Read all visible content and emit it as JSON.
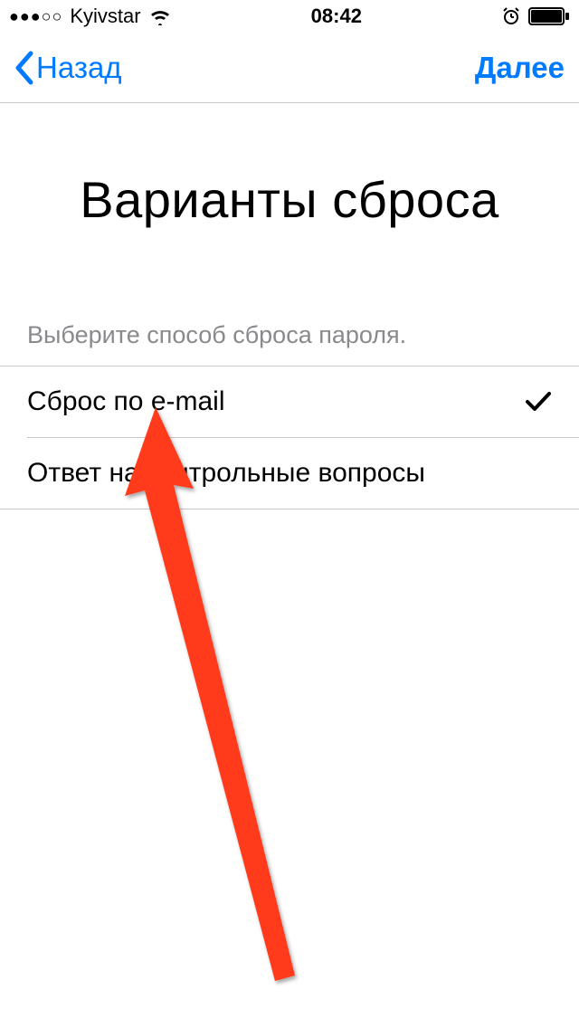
{
  "status_bar": {
    "signal_dots": "●●●○○",
    "carrier": "Kyivstar",
    "time": "08:42"
  },
  "nav": {
    "back_label": "Назад",
    "next_label": "Далее"
  },
  "page": {
    "title": "Варианты сброса",
    "subtitle": "Выберите способ сброса пароля."
  },
  "options": [
    {
      "label": "Сброс по e-mail",
      "selected": true
    },
    {
      "label": "Ответ на контрольные вопросы",
      "selected": false
    }
  ],
  "colors": {
    "link": "#007aff",
    "arrow": "#ff3b1f"
  }
}
